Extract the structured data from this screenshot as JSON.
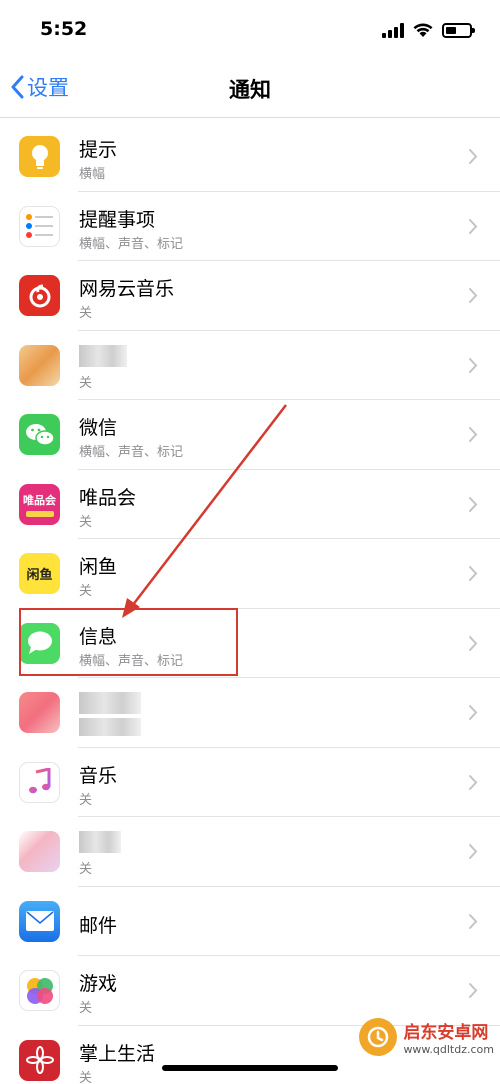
{
  "status": {
    "time": "5:52"
  },
  "nav": {
    "back_label": "设置",
    "title": "通知"
  },
  "rows": [
    {
      "title": "提示",
      "subtitle": "横幅",
      "icon": "tips-icon"
    },
    {
      "title": "提醒事项",
      "subtitle": "横幅、声音、标记",
      "icon": "reminders-icon"
    },
    {
      "title": "网易云音乐",
      "subtitle": "关",
      "icon": "netease-music-icon"
    },
    {
      "title": "",
      "subtitle": "关",
      "icon": "blurred-app-icon"
    },
    {
      "title": "微信",
      "subtitle": "横幅、声音、标记",
      "icon": "wechat-icon"
    },
    {
      "title": "唯品会",
      "subtitle": "关",
      "icon": "vipshop-icon"
    },
    {
      "title": "闲鱼",
      "subtitle": "关",
      "icon": "xianyu-icon"
    },
    {
      "title": "信息",
      "subtitle": "横幅、声音、标记",
      "icon": "messages-icon"
    },
    {
      "title": "",
      "subtitle": "",
      "icon": "blurred-app-icon"
    },
    {
      "title": "音乐",
      "subtitle": "关",
      "icon": "music-icon"
    },
    {
      "title": "",
      "subtitle": "关",
      "icon": "blurred-app-icon"
    },
    {
      "title": "邮件",
      "subtitle": "",
      "icon": "mail-icon"
    },
    {
      "title": "游戏",
      "subtitle": "关",
      "icon": "game-center-icon"
    },
    {
      "title": "掌上生活",
      "subtitle": "关",
      "icon": "zhangshang-icon"
    }
  ],
  "icon_labels": {
    "vipshop_text": "唯品会",
    "xianyu_text": "闲鱼"
  },
  "watermark": {
    "name": "启东安卓网",
    "url": "www.qdltdz.com"
  },
  "colors": {
    "accent": "#2f7cf6",
    "highlight": "#d43a2f",
    "separator": "#e3e3e5"
  }
}
